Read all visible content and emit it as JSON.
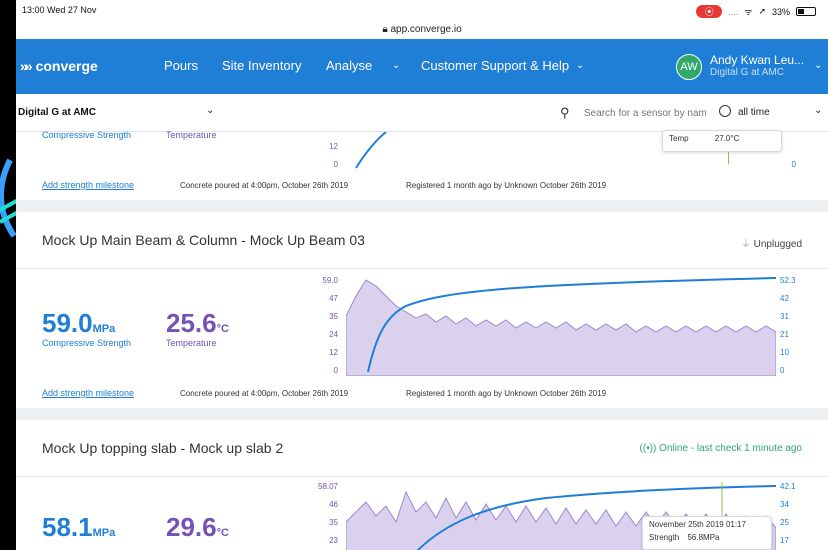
{
  "status_bar": {
    "time_date": "13:00  Wed 27 Nov",
    "battery": "33%",
    "wifi_icon": "wifi-icon",
    "location_icon": "location-arrow-icon"
  },
  "browser": {
    "url": "app.converge.io",
    "lock_icon": "lock-icon"
  },
  "nav": {
    "logo_text": "converge",
    "items": [
      "Pours",
      "Site Inventory",
      "Analyse",
      "Customer Support & Help"
    ],
    "user_initials": "AW",
    "user_name": "Andy Kwan Leu...",
    "user_org": "Digital G at AMC"
  },
  "filters": {
    "site": "Digital G at AMC",
    "search_placeholder": "Search for a sensor by name",
    "time_range": "all time"
  },
  "colors": {
    "nav_blue": "#1f7ed6",
    "strength_blue": "#1f7ed6",
    "temperature_purple": "#7552b5",
    "online_green": "#2fa86a"
  },
  "cards": [
    {
      "strength_label": "Compressive Strength",
      "temperature_label": "Temperature",
      "axis_left": [
        "12",
        "0"
      ],
      "axis_right": [
        "0"
      ],
      "tooltip": {
        "temp_label": "Temp",
        "temp_value": "27.0°C"
      },
      "add_milestone": "Add strength milestone",
      "poured": "Concrete poured at 4:00pm, October 26th 2019",
      "registered": "Registered 1 month ago by Unknown October 26th 2019"
    },
    {
      "title": "Mock Up Main Beam & Column - Mock Up Beam 03",
      "status": "Unplugged",
      "strength_value": "59.0",
      "strength_unit": "MPa",
      "strength_label": "Compressive Strength",
      "temperature_value": "25.6",
      "temperature_unit": "°C",
      "temperature_label": "Temperature",
      "axis_left": [
        "59.0",
        "47",
        "35",
        "24",
        "12",
        "0"
      ],
      "axis_right": [
        "52.3",
        "42",
        "31",
        "21",
        "10",
        "0"
      ],
      "add_milestone": "Add strength milestone",
      "poured": "Concrete poured at 4:00pm, October 26th 2019",
      "registered": "Registered 1 month ago by Unknown October 26th 2019"
    },
    {
      "title": "Mock Up topping slab - Mock up slab 2",
      "status": "Online - last check 1 minute ago",
      "strength_value": "58.1",
      "strength_unit": "MPa",
      "temperature_value": "29.6",
      "temperature_unit": "°C",
      "axis_left": [
        "58.07",
        "46",
        "35",
        "23"
      ],
      "axis_right": [
        "42.1",
        "34",
        "25",
        "17"
      ],
      "tooltip": {
        "date": "November 25th 2019 01:17",
        "strength_label": "Strength",
        "strength_value": "56.8MPa"
      }
    }
  ]
}
